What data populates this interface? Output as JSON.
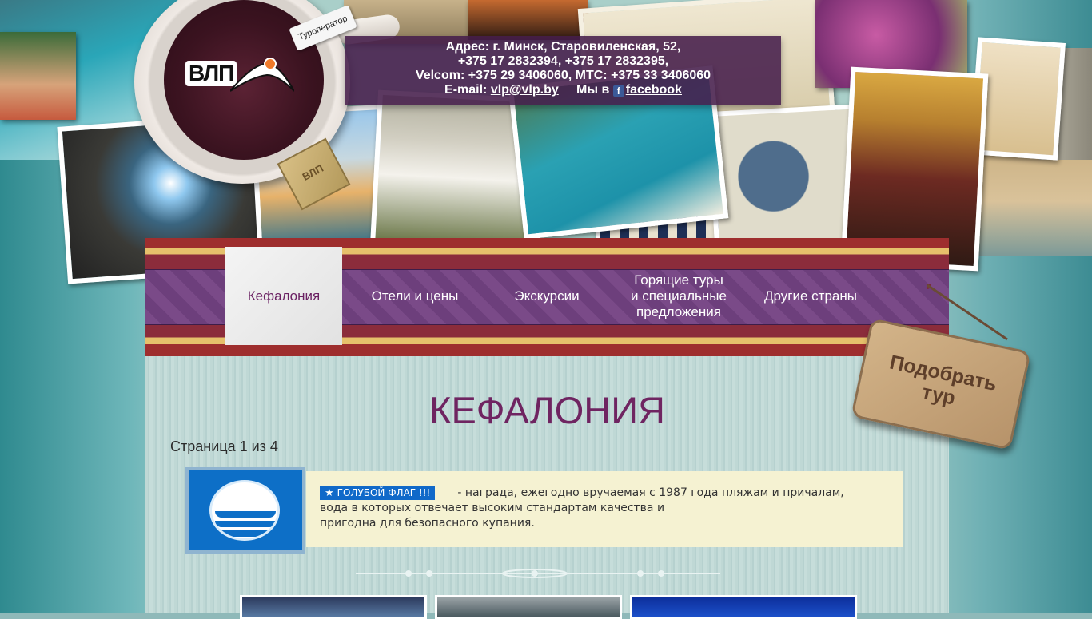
{
  "logo": {
    "text": "ВЛП",
    "tag": "Туроператор",
    "teabag": "ВЛП"
  },
  "contact": {
    "line1": "Адрес: г. Минск, Старовиленская, 52,",
    "line2": "+375 17 2832394, +375 17 2832395,",
    "line3": "Velcom: +375 29 3406060, МТС: +375 33 3406060",
    "email_label": "E-mail:",
    "email": "vlp@vlp.by",
    "social_prefix": "Мы в",
    "social_icon": "f",
    "social_link": "facebook"
  },
  "nav": {
    "items": [
      {
        "label": "Кефалония",
        "active": true
      },
      {
        "label": "Отели и цены"
      },
      {
        "label": "Экскурсии"
      },
      {
        "label_lines": [
          "Горящие туры",
          "и специальные",
          "предложения"
        ]
      },
      {
        "label": "Другие страны"
      }
    ]
  },
  "main": {
    "title": "КЕФАЛОНИЯ",
    "pager": "Страница 1 из 4"
  },
  "blue_flag": {
    "badge": "ГОЛУБОЙ ФЛАГ !!!",
    "line1": "- награда, ежегодно вручаемая с 1987 года пляжам и причалам,",
    "line2": "вода в которых отвечает высоким стандартам качества и",
    "line3": "пригодна для безопасного купания."
  },
  "sign": {
    "line1": "Подобрать",
    "line2": "тур"
  },
  "colors": {
    "nav_purple": "#7a4a88",
    "title_purple": "#6f2461",
    "contact_bg": "#461e4b",
    "flag_blue": "#0d6fc7"
  }
}
